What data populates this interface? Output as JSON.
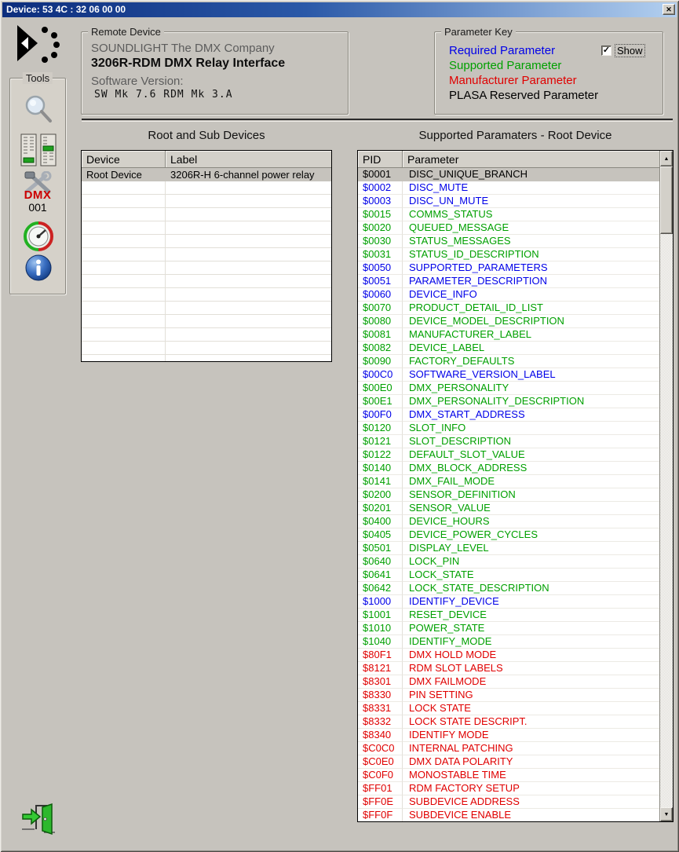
{
  "window": {
    "title": "Device:  53 4C : 32 06 00 00",
    "icons": {
      "close": "✕",
      "scroll_up": "▲",
      "scroll_down": "▼",
      "check": "✓"
    }
  },
  "remote_device": {
    "group_label": "Remote Device",
    "manufacturer": "SOUNDLIGHT The DMX Company",
    "model": "3206R-RDM DMX Relay Interface",
    "software_version_label": "Software Version:",
    "software_version_value": "SW Mk 7.6  RDM Mk 3.A"
  },
  "parameter_key": {
    "group_label": "Parameter Key",
    "entries": [
      {
        "label": "Required Parameter",
        "color": "#0000e8"
      },
      {
        "label": "Supported Parameter",
        "color": "#00a000"
      },
      {
        "label": "Manufacturer Parameter",
        "color": "#e00000"
      },
      {
        "label": "PLASA Reserved Parameter",
        "color": "#000000"
      }
    ],
    "type_colors": {
      "required": "#0000e8",
      "supported": "#00a000",
      "manufacturer": "#e00000",
      "reserved": "#000000"
    },
    "show_checkbox": {
      "label": "Show",
      "checked": true
    }
  },
  "tools": {
    "group_label": "Tools",
    "dmx_tool": {
      "label": "DMX",
      "address": "001"
    }
  },
  "devices_table": {
    "heading": "Root and Sub Devices",
    "columns": [
      "Device",
      "Label"
    ],
    "rows": [
      {
        "device": "Root Device",
        "label": "3206R-H 6-channel power relay",
        "selected": true
      }
    ],
    "empty_row_count": 14
  },
  "parameters_table": {
    "heading": "Supported Paramaters - Root Device",
    "columns": [
      "PID",
      "Parameter"
    ],
    "rows": [
      {
        "pid": "$0001",
        "name": "DISC_UNIQUE_BRANCH",
        "type": "required",
        "selected": true
      },
      {
        "pid": "$0002",
        "name": "DISC_MUTE",
        "type": "required"
      },
      {
        "pid": "$0003",
        "name": "DISC_UN_MUTE",
        "type": "required"
      },
      {
        "pid": "$0015",
        "name": "COMMS_STATUS",
        "type": "supported"
      },
      {
        "pid": "$0020",
        "name": "QUEUED_MESSAGE",
        "type": "supported"
      },
      {
        "pid": "$0030",
        "name": "STATUS_MESSAGES",
        "type": "supported"
      },
      {
        "pid": "$0031",
        "name": "STATUS_ID_DESCRIPTION",
        "type": "supported"
      },
      {
        "pid": "$0050",
        "name": "SUPPORTED_PARAMETERS",
        "type": "required"
      },
      {
        "pid": "$0051",
        "name": "PARAMETER_DESCRIPTION",
        "type": "required"
      },
      {
        "pid": "$0060",
        "name": "DEVICE_INFO",
        "type": "required"
      },
      {
        "pid": "$0070",
        "name": "PRODUCT_DETAIL_ID_LIST",
        "type": "supported"
      },
      {
        "pid": "$0080",
        "name": "DEVICE_MODEL_DESCRIPTION",
        "type": "supported"
      },
      {
        "pid": "$0081",
        "name": "MANUFACTURER_LABEL",
        "type": "supported"
      },
      {
        "pid": "$0082",
        "name": "DEVICE_LABEL",
        "type": "supported"
      },
      {
        "pid": "$0090",
        "name": "FACTORY_DEFAULTS",
        "type": "supported"
      },
      {
        "pid": "$00C0",
        "name": "SOFTWARE_VERSION_LABEL",
        "type": "required"
      },
      {
        "pid": "$00E0",
        "name": "DMX_PERSONALITY",
        "type": "supported"
      },
      {
        "pid": "$00E1",
        "name": "DMX_PERSONALITY_DESCRIPTION",
        "type": "supported"
      },
      {
        "pid": "$00F0",
        "name": "DMX_START_ADDRESS",
        "type": "required"
      },
      {
        "pid": "$0120",
        "name": "SLOT_INFO",
        "type": "supported"
      },
      {
        "pid": "$0121",
        "name": "SLOT_DESCRIPTION",
        "type": "supported"
      },
      {
        "pid": "$0122",
        "name": "DEFAULT_SLOT_VALUE",
        "type": "supported"
      },
      {
        "pid": "$0140",
        "name": "DMX_BLOCK_ADDRESS",
        "type": "supported"
      },
      {
        "pid": "$0141",
        "name": "DMX_FAIL_MODE",
        "type": "supported"
      },
      {
        "pid": "$0200",
        "name": "SENSOR_DEFINITION",
        "type": "supported"
      },
      {
        "pid": "$0201",
        "name": "SENSOR_VALUE",
        "type": "supported"
      },
      {
        "pid": "$0400",
        "name": "DEVICE_HOURS",
        "type": "supported"
      },
      {
        "pid": "$0405",
        "name": "DEVICE_POWER_CYCLES",
        "type": "supported"
      },
      {
        "pid": "$0501",
        "name": "DISPLAY_LEVEL",
        "type": "supported"
      },
      {
        "pid": "$0640",
        "name": "LOCK_PIN",
        "type": "supported"
      },
      {
        "pid": "$0641",
        "name": "LOCK_STATE",
        "type": "supported"
      },
      {
        "pid": "$0642",
        "name": "LOCK_STATE_DESCRIPTION",
        "type": "supported"
      },
      {
        "pid": "$1000",
        "name": "IDENTIFY_DEVICE",
        "type": "required"
      },
      {
        "pid": "$1001",
        "name": "RESET_DEVICE",
        "type": "supported"
      },
      {
        "pid": "$1010",
        "name": "POWER_STATE",
        "type": "supported"
      },
      {
        "pid": "$1040",
        "name": "IDENTIFY_MODE",
        "type": "supported"
      },
      {
        "pid": "$80F1",
        "name": "DMX HOLD MODE",
        "type": "manufacturer"
      },
      {
        "pid": "$8121",
        "name": "RDM SLOT LABELS",
        "type": "manufacturer"
      },
      {
        "pid": "$8301",
        "name": "DMX FAILMODE",
        "type": "manufacturer"
      },
      {
        "pid": "$8330",
        "name": "PIN SETTING",
        "type": "manufacturer"
      },
      {
        "pid": "$8331",
        "name": "LOCK STATE",
        "type": "manufacturer"
      },
      {
        "pid": "$8332",
        "name": "LOCK STATE DESCRIPT.",
        "type": "manufacturer"
      },
      {
        "pid": "$8340",
        "name": "IDENTIFY MODE",
        "type": "manufacturer"
      },
      {
        "pid": "$C0C0",
        "name": "INTERNAL PATCHING",
        "type": "manufacturer"
      },
      {
        "pid": "$C0E0",
        "name": "DMX DATA POLARITY",
        "type": "manufacturer"
      },
      {
        "pid": "$C0F0",
        "name": "MONOSTABLE TIME",
        "type": "manufacturer"
      },
      {
        "pid": "$FF01",
        "name": "RDM FACTORY SETUP",
        "type": "manufacturer"
      },
      {
        "pid": "$FF0E",
        "name": "SUBDEVICE ADDRESS",
        "type": "manufacturer"
      },
      {
        "pid": "$FF0F",
        "name": "SUBDEVICE ENABLE",
        "type": "manufacturer"
      }
    ]
  }
}
